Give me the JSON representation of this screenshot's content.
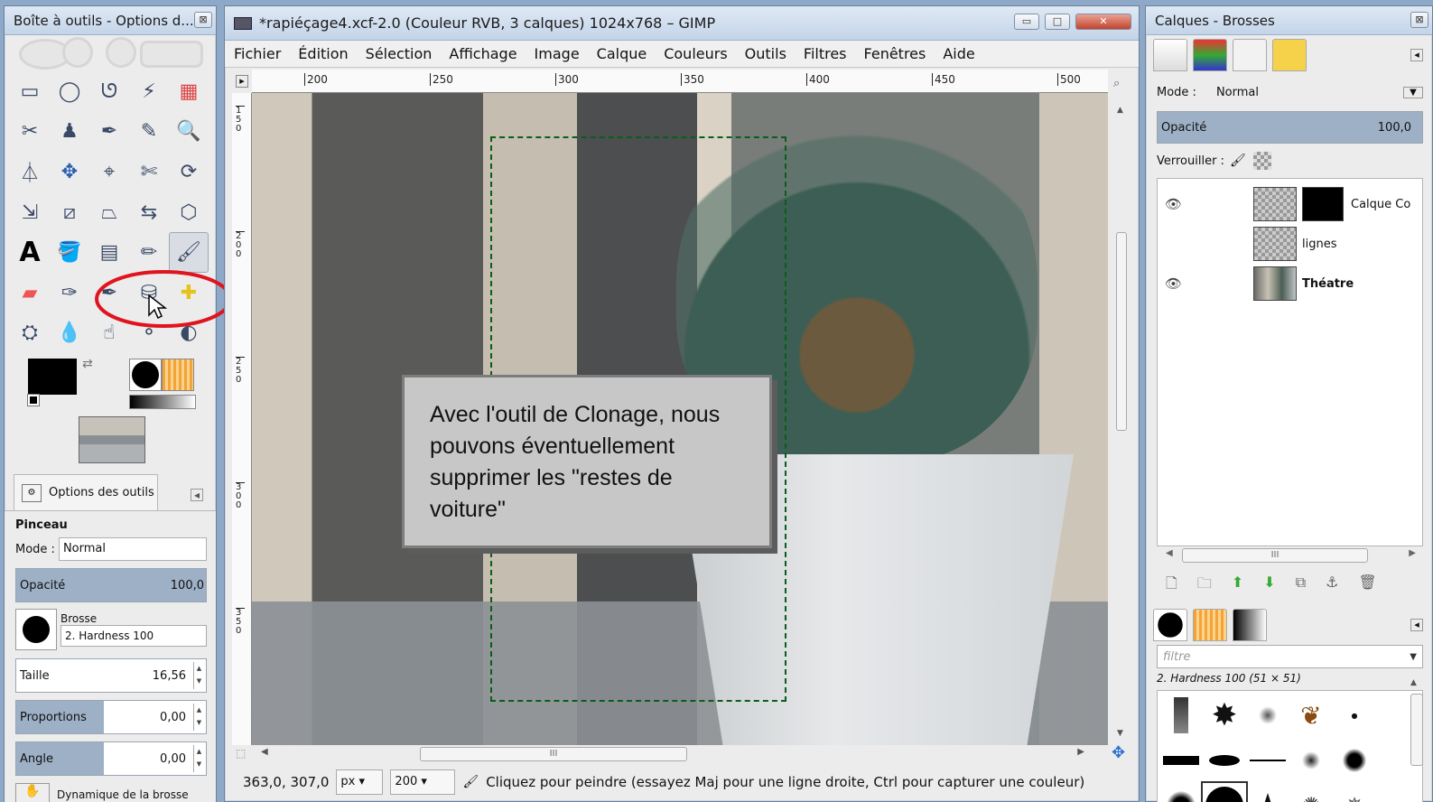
{
  "toolbox": {
    "title": "Boîte à outils - Options d...",
    "close": "⊠",
    "tools": [
      "rect-select-icon",
      "ellipse-select-icon",
      "free-select-icon",
      "fuzzy-select-icon",
      "color-select-icon",
      "scissors-select-icon",
      "foreground-select-icon",
      "paths-icon",
      "color-picker-icon",
      "zoom-icon",
      "measure-icon",
      "move-icon",
      "align-icon",
      "crop-icon",
      "rotate-icon",
      "scale-icon",
      "shear-icon",
      "perspective-icon",
      "flip-icon",
      "cage-icon",
      "text-icon",
      "bucket-fill-icon",
      "blend-icon",
      "pencil-icon",
      "paintbrush-icon",
      "eraser-icon",
      "airbrush-icon",
      "ink-icon",
      "clone-icon",
      "heal-icon",
      "perspective-clone-icon",
      "blur-icon",
      "smudge-icon",
      "dodge-burn-icon",
      "color-tool-icon"
    ],
    "options_tab": "Options des outils",
    "tool_name": "Pinceau",
    "mode_label": "Mode :",
    "mode_value": "Normal",
    "opacity_label": "Opacité",
    "opacity_value": "100,0",
    "brush_label": "Brosse",
    "brush_value": "2. Hardness 100",
    "size_label": "Taille",
    "size_value": "16,56",
    "ratio_label": "Proportions",
    "ratio_value": "0,00",
    "angle_label": "Angle",
    "angle_value": "0,00",
    "dynamics_label": "Dynamique de la brosse"
  },
  "image_window": {
    "title": "*rapiéçage4.xcf-2.0 (Couleur RVB, 3 calques) 1024x768 – GIMP",
    "menu": [
      "Fichier",
      "Édition",
      "Sélection",
      "Affichage",
      "Image",
      "Calque",
      "Couleurs",
      "Outils",
      "Filtres",
      "Fenêtres",
      "Aide"
    ],
    "hruler_ticks": [
      "200",
      "250",
      "300",
      "350",
      "400",
      "450",
      "500"
    ],
    "vruler_ticks": [
      "150",
      "200",
      "250",
      "300",
      "350"
    ],
    "callout_text": "Avec l'outil de Clonage, nous pouvons éventuellement supprimer les \"restes de voiture\"",
    "coords": "363,0, 307,0",
    "unit": "px",
    "zoom": "200",
    "status_msg": "Cliquez pour peindre (essayez Maj pour une ligne droite, Ctrl pour capturer une couleur)",
    "hscroll_grip": "III"
  },
  "dock": {
    "title": "Calques - Brosses",
    "close": "⊠",
    "mode_label": "Mode :",
    "mode_value": "Normal",
    "opacity_label": "Opacité",
    "opacity_value": "100,0",
    "lock_label": "Verrouiller :",
    "layers": [
      {
        "name": "Calque Co",
        "visible": true
      },
      {
        "name": "lignes",
        "visible": false
      },
      {
        "name": "Théatre",
        "visible": true
      }
    ],
    "scroll_grip": "III",
    "filter_placeholder": "filtre",
    "brush_info": "2. Hardness 100 (51 × 51)"
  },
  "colors": {
    "highlight_circle": "#e0141e",
    "selection_dash": "#0a5e18",
    "fg": "#000000",
    "bg": "#ffffff"
  }
}
